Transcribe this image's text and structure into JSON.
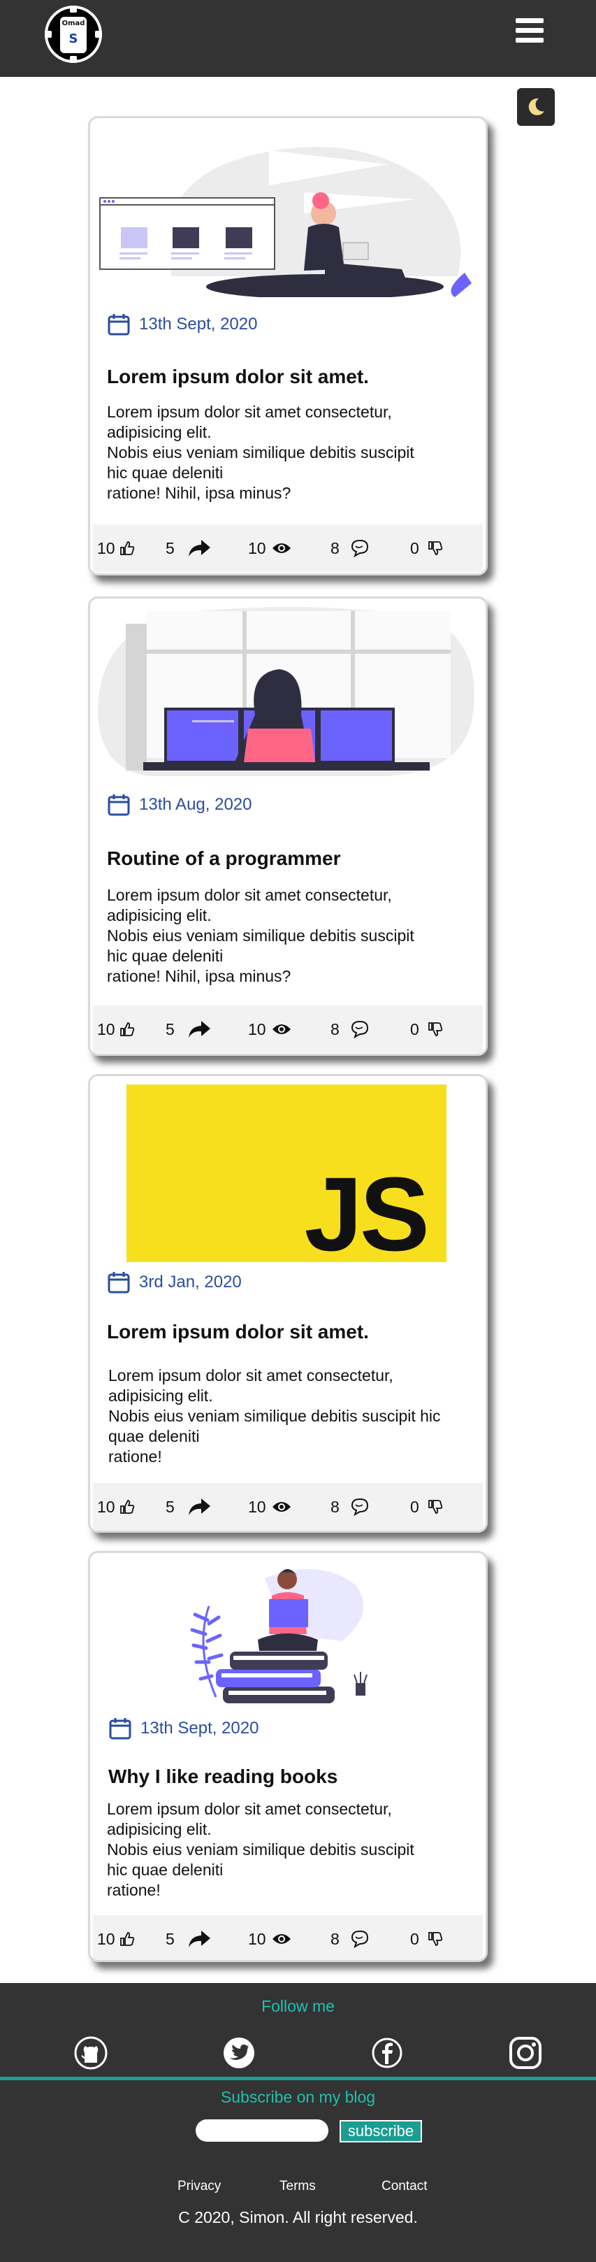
{
  "header": {
    "logo_top": "Omad",
    "logo_mid": "S",
    "menu_icon": "hamburger-icon",
    "theme_icon": "moon-icon"
  },
  "posts": [
    {
      "date": "13th Sept, 2020",
      "title": "Lorem ipsum dolor sit amet.",
      "text": "Lorem ipsum dolor sit amet consectetur,\nadipisicing elit.\nNobis eius veniam similique debitis suscipit\nhic quae deleniti\nratione! Nihil, ipsa minus?",
      "stats": {
        "likes": "10",
        "shares": "5",
        "views": "10",
        "comments": "8",
        "dislikes": "0"
      }
    },
    {
      "date": "13th Aug, 2020",
      "title": "Routine of a programmer",
      "text": "Lorem ipsum dolor sit amet consectetur,\nadipisicing elit.\nNobis eius veniam similique debitis suscipit\nhic quae deleniti\nratione! Nihil, ipsa minus?",
      "stats": {
        "likes": "10",
        "shares": "5",
        "views": "10",
        "comments": "8",
        "dislikes": "0"
      }
    },
    {
      "date": "3rd Jan, 2020",
      "title": "Lorem ipsum dolor sit amet.",
      "logo_text": "JS",
      "text": "Lorem ipsum dolor sit amet consectetur,\nadipisicing elit.\nNobis eius veniam similique debitis suscipit hic\nquae deleniti\nratione!",
      "stats": {
        "likes": "10",
        "shares": "5",
        "views": "10",
        "comments": "8",
        "dislikes": "0"
      }
    },
    {
      "date": "13th Sept, 2020",
      "title": "Why I like reading books",
      "text": "Lorem ipsum dolor sit amet consectetur,\nadipisicing elit.\nNobis eius veniam similique debitis suscipit\nhic quae deleniti\nratione!",
      "stats": {
        "likes": "10",
        "shares": "5",
        "views": "10",
        "comments": "8",
        "dislikes": "0"
      }
    }
  ],
  "footer": {
    "follow_label": "Follow me",
    "social_icons": [
      "github-icon",
      "twitter-icon",
      "facebook-icon",
      "instagram-icon"
    ],
    "subscribe_label": "Subscribe on my blog",
    "subscribe_button": "subscribe",
    "links": [
      "Privacy",
      "Terms",
      "Contact"
    ],
    "copyright": "C 2020, Simon. All right reserved."
  },
  "colors": {
    "nav_bg": "#333333",
    "accent": "#1fc1b0",
    "date_blue": "#2a4d9e",
    "illustration_purple": "#6c63ff",
    "js_yellow": "#f7df1e"
  }
}
